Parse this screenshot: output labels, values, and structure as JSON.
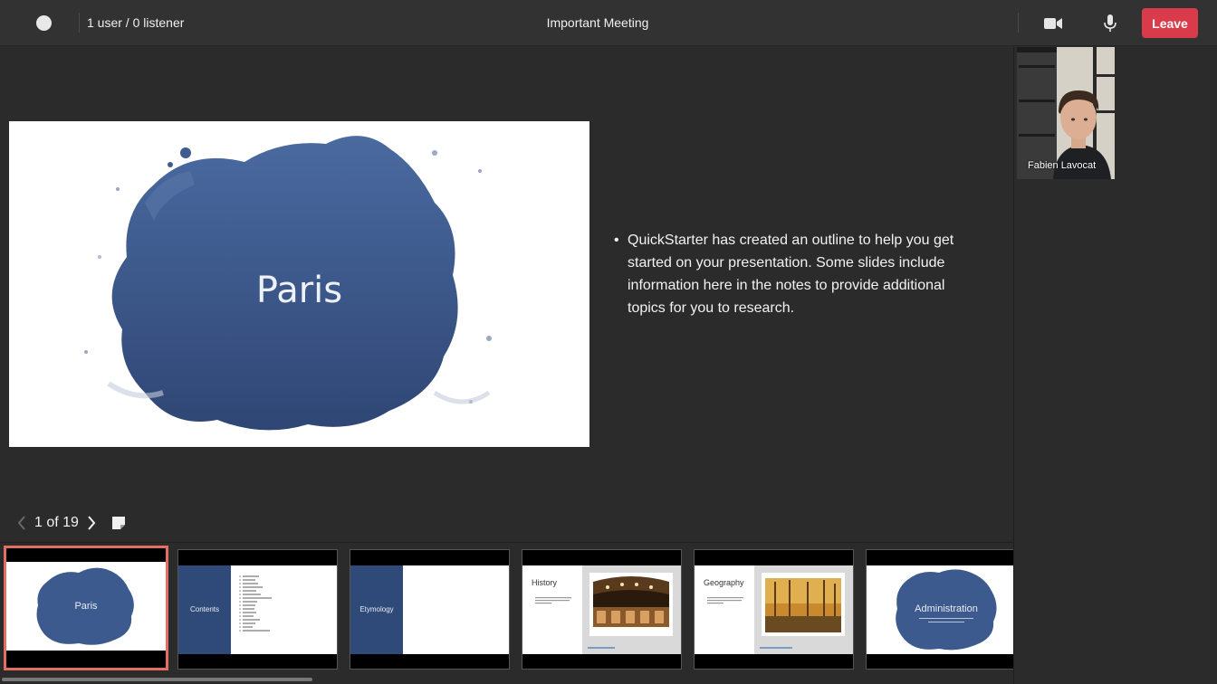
{
  "header": {
    "user_count": "1 user / 0 listener",
    "meeting_title": "Important Meeting",
    "leave_label": "Leave",
    "icons": [
      "status-dot",
      "video-camera-icon",
      "microphone-icon"
    ]
  },
  "slide": {
    "title": "Paris",
    "colors": {
      "splash": "#3d5a8e",
      "splash_dark": "#2a3f6b"
    }
  },
  "notes": {
    "items": [
      "QuickStarter has created an outline to help you get started on your presentation. Some slides include information here in the notes to provide additional topics for you to research."
    ]
  },
  "pager": {
    "text": "1 of 19",
    "current": 1,
    "total": 19
  },
  "thumbnails": [
    {
      "label": "Paris",
      "active": true
    },
    {
      "label": "Contents",
      "active": false
    },
    {
      "label": "Etymology",
      "active": false
    },
    {
      "label": "History",
      "active": false
    },
    {
      "label": "Geography",
      "active": false
    },
    {
      "label": "Administration",
      "active": false
    }
  ],
  "participant": {
    "name": "Fabien Lavocat"
  },
  "colors": {
    "leave": "#d93b4b",
    "active_thumb_border": "#e26f62",
    "background": "#2b2b2b"
  }
}
